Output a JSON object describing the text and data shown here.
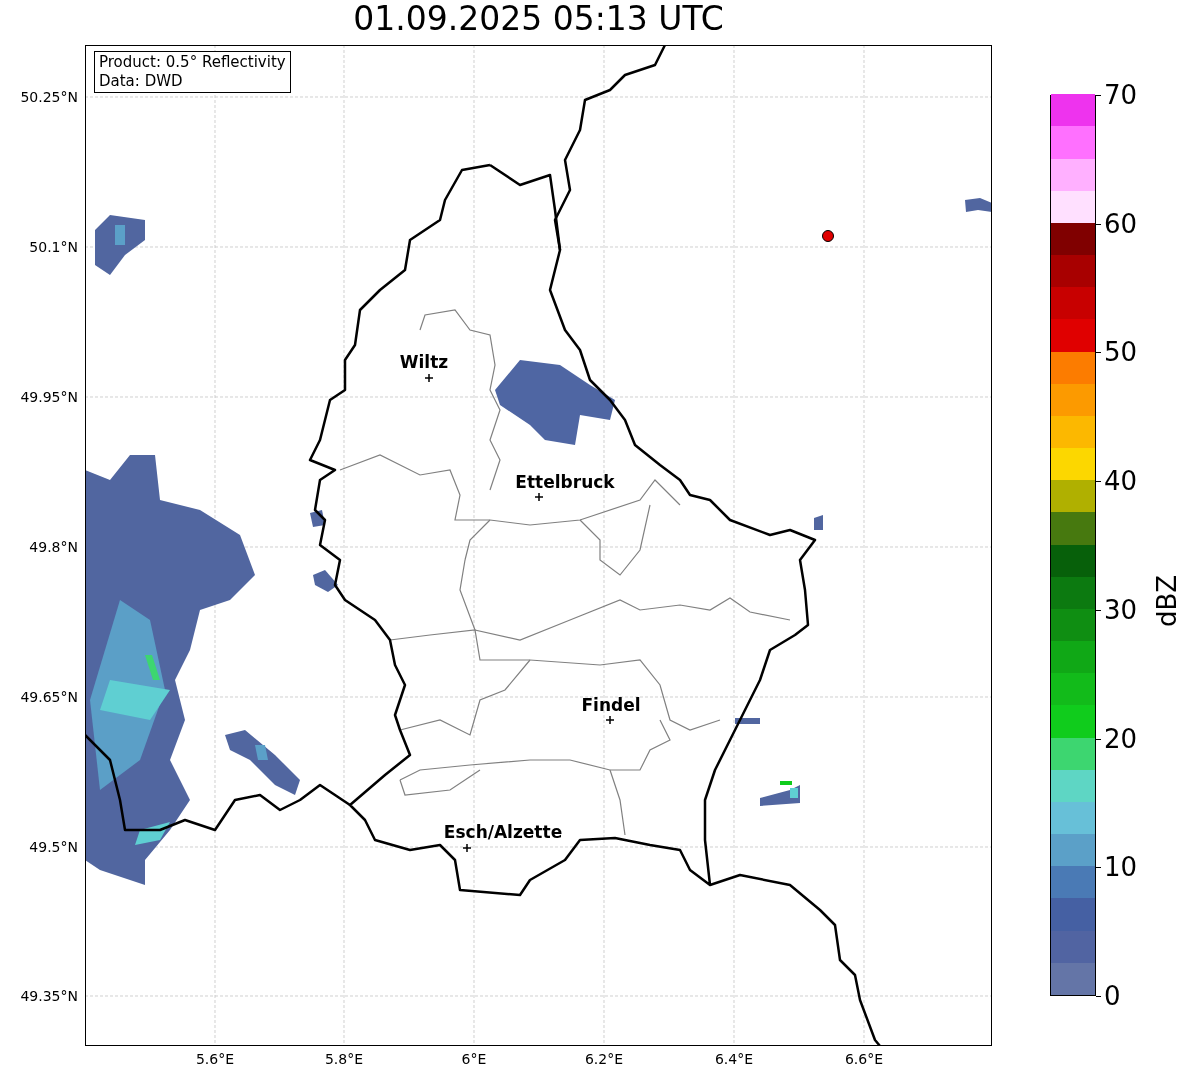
{
  "title": "01.09.2025 05:13 UTC",
  "info": [
    "Product: 0.5° Reflectivity",
    "Data: DWD"
  ],
  "lat_labels": [
    "50.25°N",
    "50.1°N",
    "49.95°N",
    "49.8°N",
    "49.65°N",
    "49.5°N",
    "49.35°N"
  ],
  "lon_labels": [
    "5.6°E",
    "5.8°E",
    "6°E",
    "6.2°E",
    "6.4°E",
    "6.6°E"
  ],
  "cities": [
    {
      "name": "Wiltz"
    },
    {
      "name": "Ettelbruck"
    },
    {
      "name": "Findel"
    },
    {
      "name": "Esch/Alzette"
    }
  ],
  "colorbar": {
    "label": "dBZ",
    "ticks": [
      "70",
      "60",
      "50",
      "40",
      "30",
      "20",
      "10",
      "0"
    ],
    "segments": [
      {
        "color": "#6475a7"
      },
      {
        "color": "#5164a2"
      },
      {
        "color": "#4560a3"
      },
      {
        "color": "#4a7ab5"
      },
      {
        "color": "#5ba0c8"
      },
      {
        "color": "#67c0d8"
      },
      {
        "color": "#5ed6c4"
      },
      {
        "color": "#3dd670"
      },
      {
        "color": "#10cc1c"
      },
      {
        "color": "#12bb1a"
      },
      {
        "color": "#10a816"
      },
      {
        "color": "#0f8e12"
      },
      {
        "color": "#0c7a10"
      },
      {
        "color": "#07600a"
      },
      {
        "color": "#47790f"
      },
      {
        "color": "#b0b000"
      },
      {
        "color": "#fcd700"
      },
      {
        "color": "#fcb800"
      },
      {
        "color": "#fc9a00"
      },
      {
        "color": "#fc7c00"
      },
      {
        "color": "#e00000"
      },
      {
        "color": "#c80000"
      },
      {
        "color": "#a80000"
      },
      {
        "color": "#800000"
      },
      {
        "color": "#ffe0ff"
      },
      {
        "color": "#ffb0ff"
      },
      {
        "color": "#ff70ff"
      },
      {
        "color": "#ee33ee"
      }
    ]
  }
}
